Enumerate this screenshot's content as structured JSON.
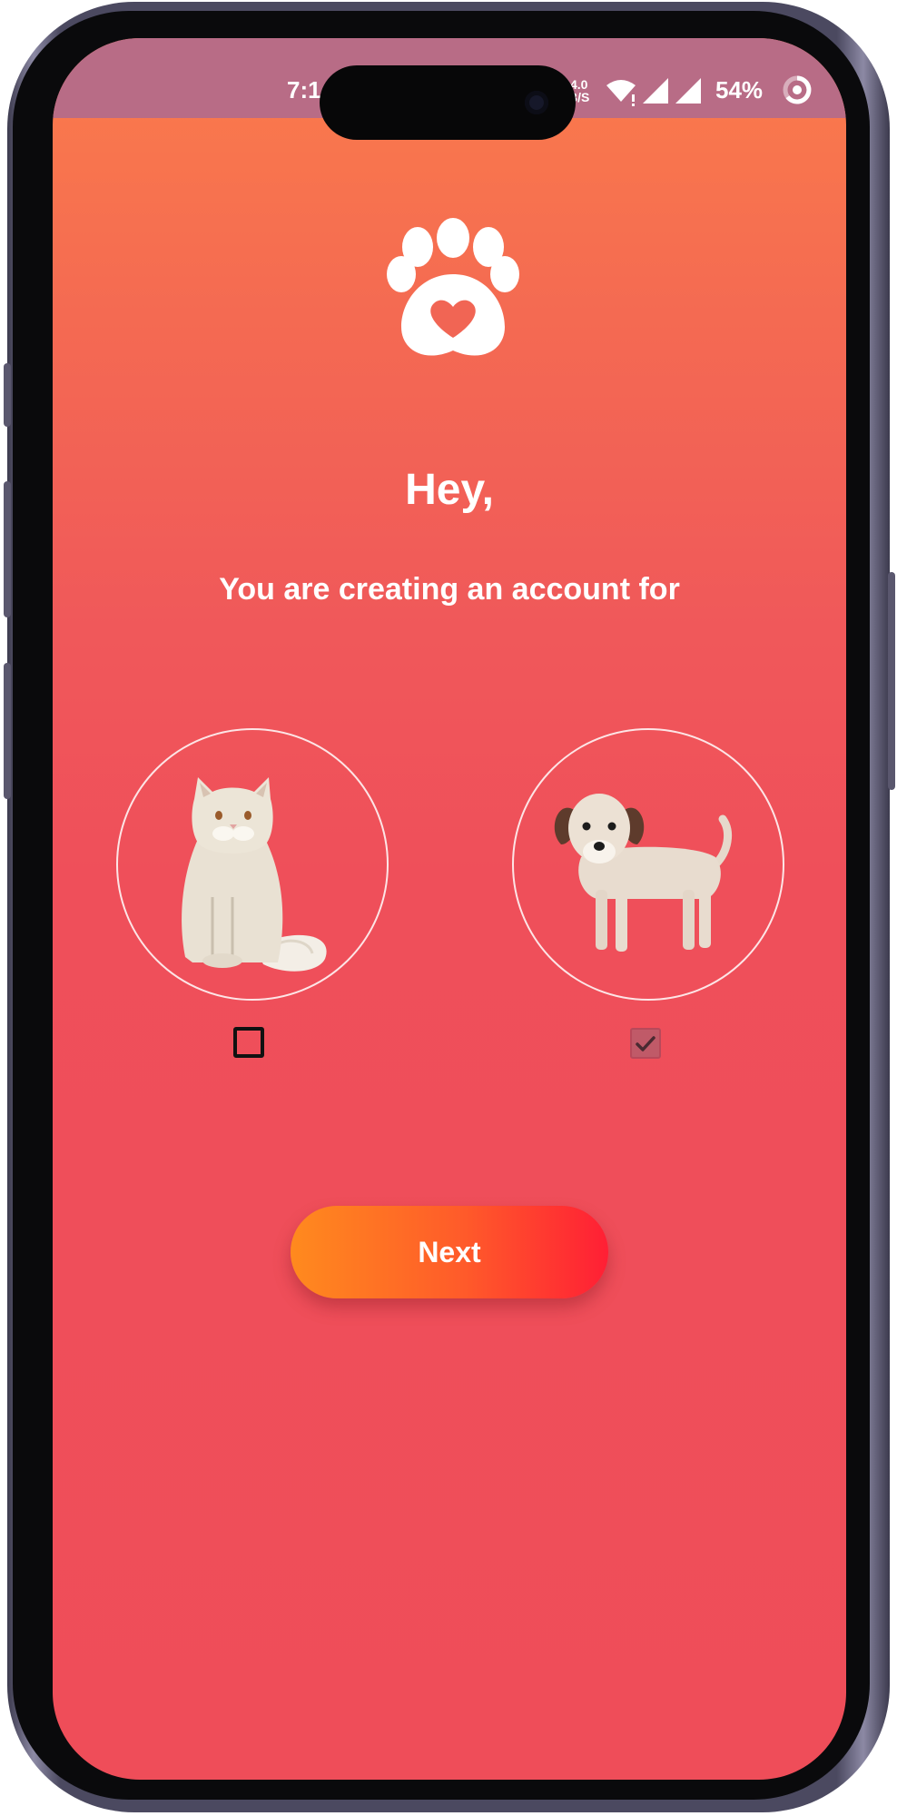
{
  "status_bar": {
    "time": "7:1",
    "network_speed_top": "4.0",
    "network_speed_bottom": "B/S",
    "battery": "54%",
    "icons": [
      "wifi-icon",
      "signal-icon",
      "signal-icon",
      "battery-ring-icon"
    ]
  },
  "logo": {
    "icon": "paw-heart-icon"
  },
  "header": {
    "title": "Hey,",
    "subtitle": "You are creating an account for"
  },
  "pets": [
    {
      "name": "cat",
      "icon": "cat-illustration",
      "checked": false
    },
    {
      "name": "dog",
      "icon": "dog-illustration",
      "checked": true
    }
  ],
  "actions": {
    "next_label": "Next"
  },
  "colors": {
    "gradient_top": "#fb7c4b",
    "gradient_bottom": "#ef4d59",
    "status_bar": "#b86c86",
    "button_start": "#ff8a1e",
    "button_end": "#ff1f35",
    "checkbox_checked": "#c05a68"
  }
}
